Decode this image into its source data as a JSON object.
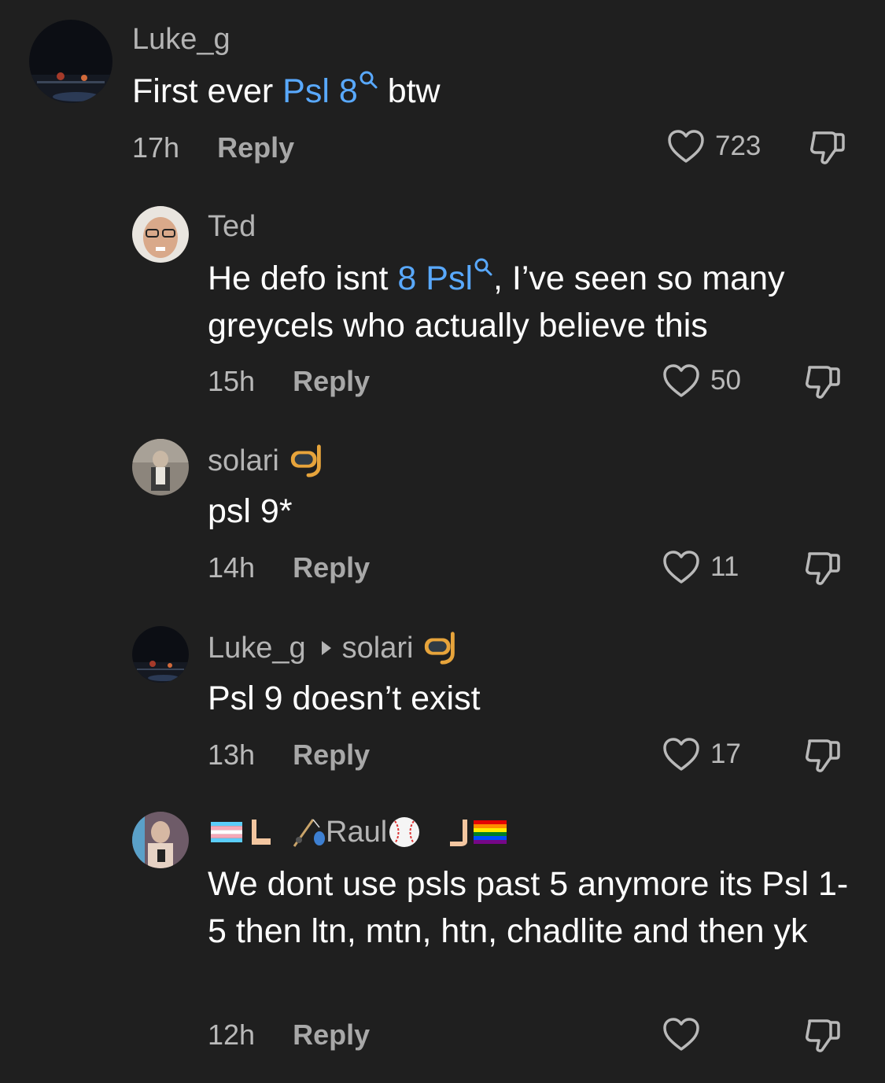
{
  "comments": [
    {
      "username": "Luke_g",
      "text_parts": [
        "First ever ",
        "Psl 8",
        " btw"
      ],
      "time": "17h",
      "reply_label": "Reply",
      "likes": "723"
    },
    {
      "username": "Ted",
      "text_parts": [
        "He defo isnt ",
        "8 Psl",
        ", I’ve seen so many greycels who actually believe this"
      ],
      "time": "15h",
      "reply_label": "Reply",
      "likes": "50"
    },
    {
      "username": "solari",
      "text": "psl 9*",
      "time": "14h",
      "reply_label": "Reply",
      "likes": "11"
    },
    {
      "username": "Luke_g",
      "reply_to": "solari",
      "text": "Psl 9 doesn’t exist",
      "time": "13h",
      "reply_label": "Reply",
      "likes": "17"
    },
    {
      "username": "Raul",
      "text": "We dont use psls past 5 anymore its Psl 1-5 then ltn, mtn, htn, chadlite and then yk",
      "time": "12h",
      "reply_label": "Reply",
      "likes": ""
    }
  ],
  "colors": {
    "background": "#1f1f1f",
    "keyword": "#59a9ff",
    "muted": "#b4b4b4"
  },
  "icons": {
    "like": "heart-outline-icon",
    "dislike": "thumbs-down-outline-icon",
    "search": "search-icon"
  }
}
